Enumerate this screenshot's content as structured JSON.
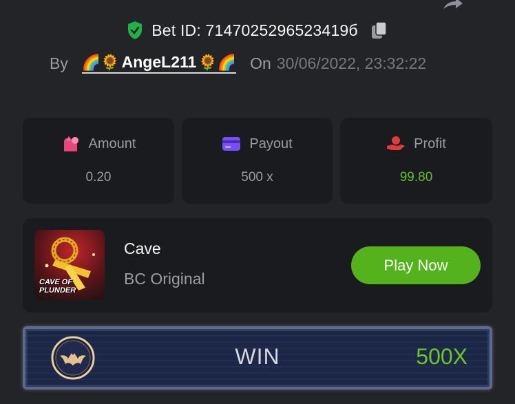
{
  "header": {
    "bet_id": "Bet ID: 7147025296523419б",
    "by_label": "By",
    "username": "AngeL211",
    "emoji_left": "🌈🌻",
    "emoji_right": "🌻🌈",
    "on_label": "On",
    "date": "30/06/2022, 23:32:22"
  },
  "stats": {
    "amount_label": "Amount",
    "amount_value": "0.20",
    "payout_label": "Payout",
    "payout_value": "500 x",
    "profit_label": "Profit",
    "profit_value": "99.80"
  },
  "game": {
    "name": "Cave",
    "subtitle": "BC Original",
    "thumbnail_title_line1": "CAVE OF",
    "thumbnail_title_line2": "PLUNDER",
    "play_label": "Play Now"
  },
  "result": {
    "label": "WIN",
    "multiplier": "500X"
  },
  "colors": {
    "background": "#232427",
    "card": "#1a1b1e",
    "accent_green": "#54b31c",
    "profit_green": "#5dc12b",
    "amount_icon": "#e8457a",
    "payout_icon": "#7c4dff",
    "profit_icon": "#e33b3b"
  },
  "icons": {
    "share": "share-arrow-icon",
    "verified": "shield-check-icon",
    "copy": "copy-icon",
    "amount": "money-bag-icon",
    "payout": "card-icon",
    "profit": "hand-coin-icon",
    "result_badge": "bat-coin-icon"
  }
}
